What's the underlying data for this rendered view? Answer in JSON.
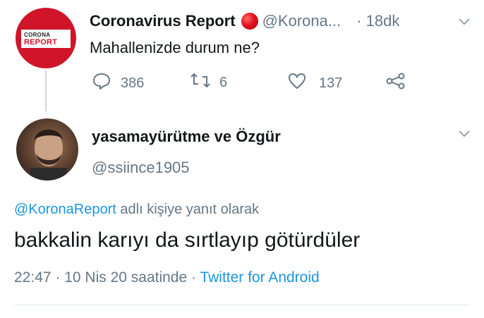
{
  "parent_tweet": {
    "avatar_logo": {
      "line1": "CORONA",
      "line2": "REPORT"
    },
    "display_name": "Coronavirus Report",
    "handle": "@Korona...",
    "time": "18dk",
    "text": "Mahallenizde durum ne?",
    "actions": {
      "replies": "386",
      "retweets": "6",
      "likes": "137"
    }
  },
  "reply_tweet": {
    "display_name": "yasamayürütme ve Özgür",
    "handle": "@ssiince1905",
    "replying_to_mention": "@KoronaReport",
    "replying_to_suffix": " adlı kişiye yanıt olarak",
    "text": "bakkalin karıyı da sırtlayıp götürdüler",
    "timestamp": "22:47 · 10 Nis 20 saatinde · ",
    "client": "Twitter for Android"
  },
  "colors": {
    "accent": "#1b95e0",
    "brand_red": "#d0152b",
    "muted": "#657786"
  },
  "icons": [
    "reply-icon",
    "retweet-icon",
    "like-icon",
    "share-icon",
    "chevron-down-icon",
    "verified-badge-icon"
  ]
}
